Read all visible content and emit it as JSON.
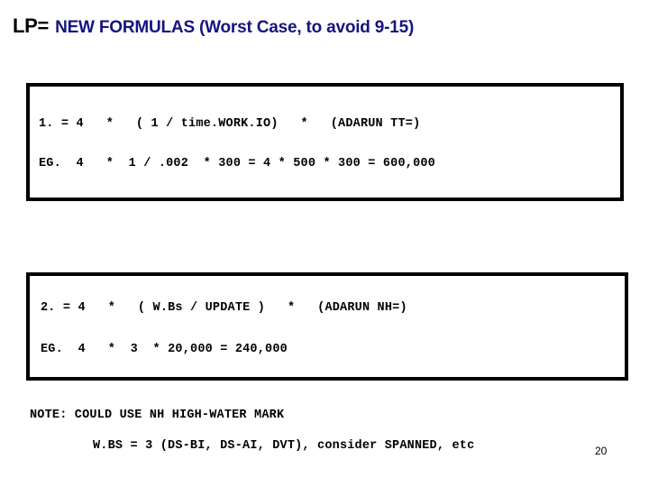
{
  "slide": {
    "title": {
      "prefix": "LP=",
      "main": "NEW FORMULAS (Worst Case, to avoid 9-15)",
      "prefix_color": "#000000",
      "main_color": "#141482"
    },
    "formula_box_1": {
      "main_line": "1. = 4   *   ( 1 / time.WORK.IO)   *   (ADARUN TT=)",
      "example_line": "EG.  4   *  1 / .002  * 300 = 4 * 500 * 300 = 600,000",
      "border_color": "#000000"
    },
    "formula_box_2": {
      "main_line": "2. = 4   *   ( W.Bs / UPDATE )   *   (ADARUN NH=)",
      "example_line": "EG.  4   *  3  * 20,000 = 240,000",
      "border_color": "#000000"
    },
    "note": {
      "heading": "NOTE: COULD USE NH HIGH-WATER MARK",
      "detail": "W.BS = 3 (DS-BI, DS-AI, DVT), consider SPANNED, etc"
    },
    "page_number": "20"
  }
}
